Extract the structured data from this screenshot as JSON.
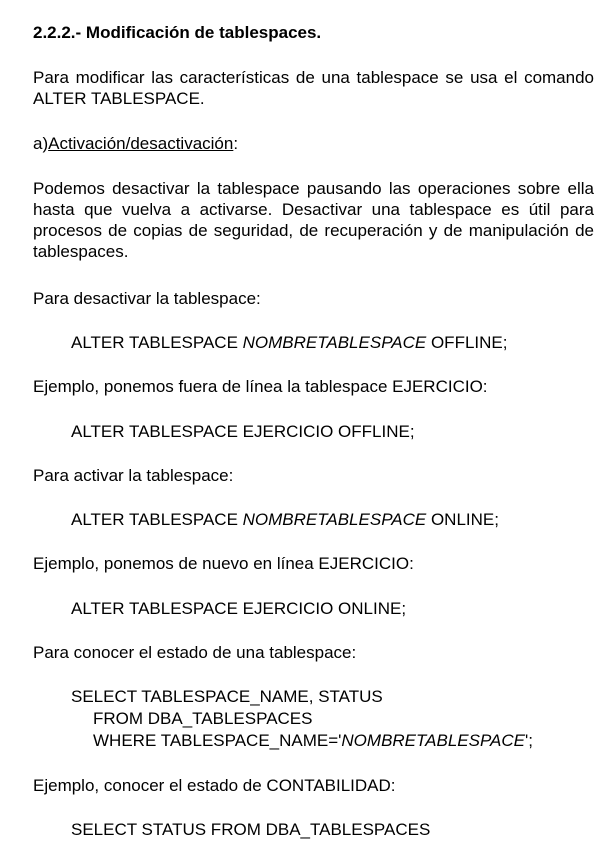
{
  "section_heading": "2.2.2.- Modificación de tablespaces.",
  "intro": "Para modificar las características de una tablespace se usa el comando ALTER TABLESPACE.",
  "subsection": {
    "prefix": "a)",
    "title": "Activación/desactivación",
    "suffix": ":"
  },
  "para_deactivate": "Podemos desactivar la tablespace pausando las operaciones sobre ella hasta que vuelva a activarse. Desactivar una tablespace es útil para procesos de copias de seguridad, de recuperación y de manipulación de tablespaces.",
  "lead_deactivate": "Para desactivar la tablespace:",
  "code_offline_generic": {
    "pre": "ALTER TABLESPACE ",
    "placeholder": "NOMBRETABLESPACE",
    "post": " OFFLINE;"
  },
  "example_offline_text": "Ejemplo, ponemos fuera de línea la tablespace EJERCICIO:",
  "code_offline_example": "ALTER TABLESPACE EJERCICIO OFFLINE;",
  "lead_activate": "Para activar la tablespace:",
  "code_online_generic": {
    "pre": "ALTER TABLESPACE ",
    "placeholder": "NOMBRETABLESPACE",
    "post": " ONLINE;"
  },
  "example_online_text": "Ejemplo, ponemos de nuevo en línea EJERCICIO:",
  "code_online_example": "ALTER TABLESPACE EJERCICIO ONLINE;",
  "lead_status": "Para conocer el estado de una tablespace:",
  "code_status_query": {
    "line1": "SELECT TABLESPACE_NAME, STATUS",
    "line2": "FROM DBA_TABLESPACES",
    "line3_pre": "WHERE TABLESPACE_NAME='",
    "line3_placeholder": "NOMBRETABLESPACE",
    "line3_post": "';"
  },
  "example_status_text": "Ejemplo, conocer el estado de CONTABILIDAD:",
  "code_status_example_line1": "SELECT STATUS FROM DBA_TABLESPACES"
}
